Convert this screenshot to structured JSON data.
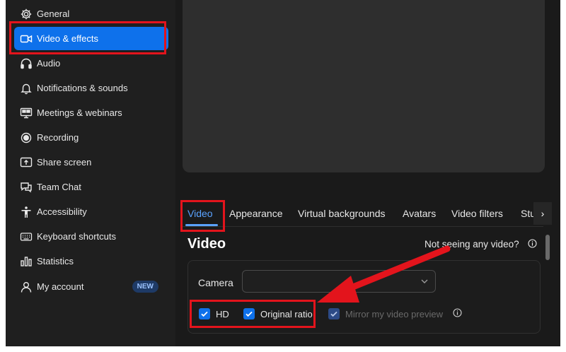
{
  "sidebar": {
    "items": [
      {
        "label": "General",
        "icon": "gear-icon"
      },
      {
        "label": "Video & effects",
        "icon": "video-camera-icon",
        "active": true
      },
      {
        "label": "Audio",
        "icon": "headphones-icon"
      },
      {
        "label": "Notifications & sounds",
        "icon": "bell-icon"
      },
      {
        "label": "Meetings & webinars",
        "icon": "meetings-icon"
      },
      {
        "label": "Recording",
        "icon": "record-icon"
      },
      {
        "label": "Share screen",
        "icon": "share-screen-icon"
      },
      {
        "label": "Team Chat",
        "icon": "chat-icon"
      },
      {
        "label": "Accessibility",
        "icon": "accessibility-icon"
      },
      {
        "label": "Keyboard shortcuts",
        "icon": "keyboard-icon"
      },
      {
        "label": "Statistics",
        "icon": "statistics-icon"
      },
      {
        "label": "My account",
        "icon": "user-icon",
        "badge": "NEW"
      }
    ]
  },
  "tabs": [
    {
      "label": "Video",
      "active": true
    },
    {
      "label": "Appearance"
    },
    {
      "label": "Virtual backgrounds"
    },
    {
      "label": "Avatars"
    },
    {
      "label": "Video filters"
    },
    {
      "label": "Stu"
    }
  ],
  "section": {
    "title": "Video",
    "help_link": "Not seeing any video?"
  },
  "camera": {
    "label": "Camera",
    "value": ""
  },
  "options": [
    {
      "label": "HD",
      "checked": true
    },
    {
      "label": "Original ratio",
      "checked": true
    },
    {
      "label": "Mirror my video preview",
      "checked": true,
      "disabled": true
    }
  ],
  "colors": {
    "accent": "#0e71eb",
    "annotation": "#e3141c",
    "background": "#1a1a1a"
  }
}
